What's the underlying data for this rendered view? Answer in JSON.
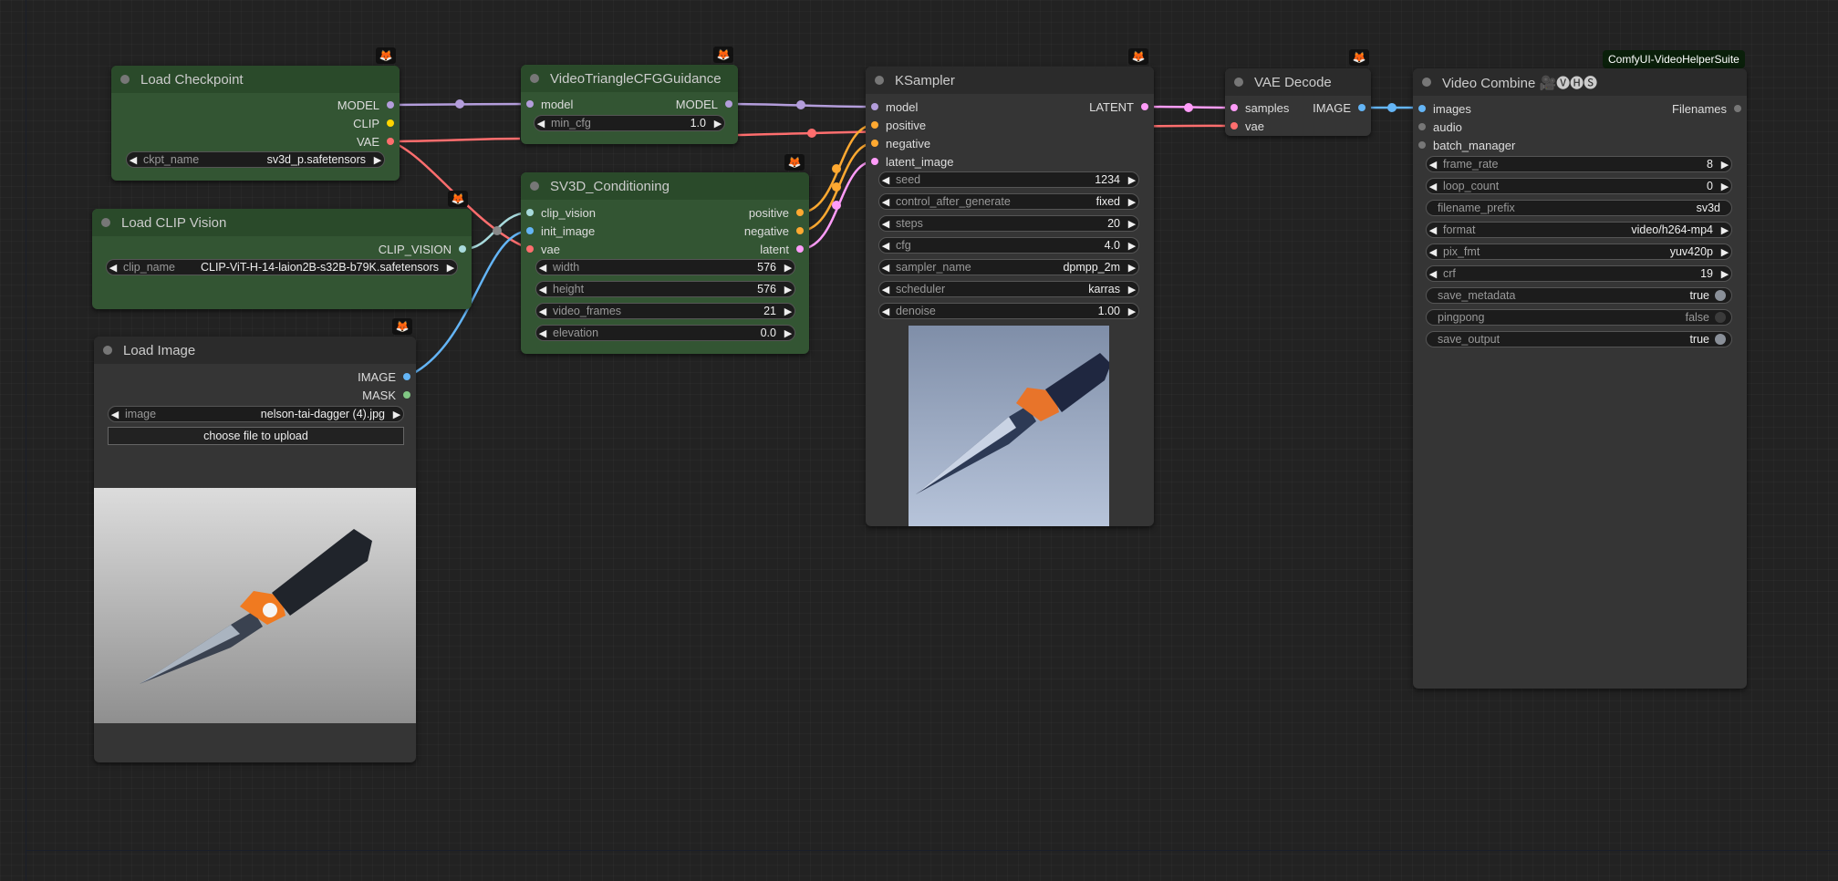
{
  "colors": {
    "model": "#b39ddb",
    "clip": "#ffd500",
    "vae": "#ff6e6e",
    "clip_vision": "#a8dadc",
    "image": "#64b5f6",
    "mask": "#81c784",
    "conditioning": "#ffa931",
    "latent": "#ff9cf9",
    "badge_fox": "#ff8c1a"
  },
  "badge_icon": "fox-icon",
  "load_checkpoint": {
    "title": "Load Checkpoint",
    "outputs": [
      "MODEL",
      "CLIP",
      "VAE"
    ],
    "ckpt_name": {
      "label": "ckpt_name",
      "value": "sv3d_p.safetensors"
    }
  },
  "load_clip_vision": {
    "title": "Load CLIP Vision",
    "outputs": [
      "CLIP_VISION"
    ],
    "clip_name": {
      "label": "clip_name",
      "value": "CLIP-ViT-H-14-laion2B-s32B-b79K.safetensors"
    }
  },
  "load_image": {
    "title": "Load Image",
    "outputs": [
      "IMAGE",
      "MASK"
    ],
    "image": {
      "label": "image",
      "value": "nelson-tai-dagger (4).jpg"
    },
    "upload_label": "choose file to upload"
  },
  "video_triangle": {
    "title": "VideoTriangleCFGGuidance",
    "input": "model",
    "output": "MODEL",
    "min_cfg": {
      "label": "min_cfg",
      "value": "1.0"
    }
  },
  "sv3d": {
    "title": "SV3D_Conditioning",
    "inputs": [
      "clip_vision",
      "init_image",
      "vae"
    ],
    "outputs": [
      "positive",
      "negative",
      "latent"
    ],
    "widgets": [
      {
        "label": "width",
        "value": "576"
      },
      {
        "label": "height",
        "value": "576"
      },
      {
        "label": "video_frames",
        "value": "21"
      },
      {
        "label": "elevation",
        "value": "0.0"
      }
    ]
  },
  "ksampler": {
    "title": "KSampler",
    "inputs": [
      "model",
      "positive",
      "negative",
      "latent_image"
    ],
    "output": "LATENT",
    "widgets": [
      {
        "label": "seed",
        "value": "1234"
      },
      {
        "label": "control_after_generate",
        "value": "fixed"
      },
      {
        "label": "steps",
        "value": "20"
      },
      {
        "label": "cfg",
        "value": "4.0"
      },
      {
        "label": "sampler_name",
        "value": "dpmpp_2m"
      },
      {
        "label": "scheduler",
        "value": "karras"
      },
      {
        "label": "denoise",
        "value": "1.00"
      }
    ]
  },
  "vae_decode": {
    "title": "VAE Decode",
    "inputs": [
      "samples",
      "vae"
    ],
    "output": "IMAGE"
  },
  "video_combine": {
    "title": "Video Combine 🎥🅥🅗🅢",
    "brand": "ComfyUI-VideoHelperSuite",
    "inputs": [
      "images",
      "audio",
      "batch_manager"
    ],
    "output": "Filenames",
    "widgets": [
      {
        "label": "frame_rate",
        "value": "8",
        "kind": "number"
      },
      {
        "label": "loop_count",
        "value": "0",
        "kind": "number"
      },
      {
        "label": "filename_prefix",
        "value": "sv3d",
        "kind": "text"
      },
      {
        "label": "format",
        "value": "video/h264-mp4",
        "kind": "combo"
      },
      {
        "label": "pix_fmt",
        "value": "yuv420p",
        "kind": "combo"
      },
      {
        "label": "crf",
        "value": "19",
        "kind": "number"
      },
      {
        "label": "save_metadata",
        "value": "true",
        "kind": "toggle",
        "on": true
      },
      {
        "label": "pingpong",
        "value": "false",
        "kind": "toggle",
        "on": false
      },
      {
        "label": "save_output",
        "value": "true",
        "kind": "toggle",
        "on": true
      }
    ]
  }
}
